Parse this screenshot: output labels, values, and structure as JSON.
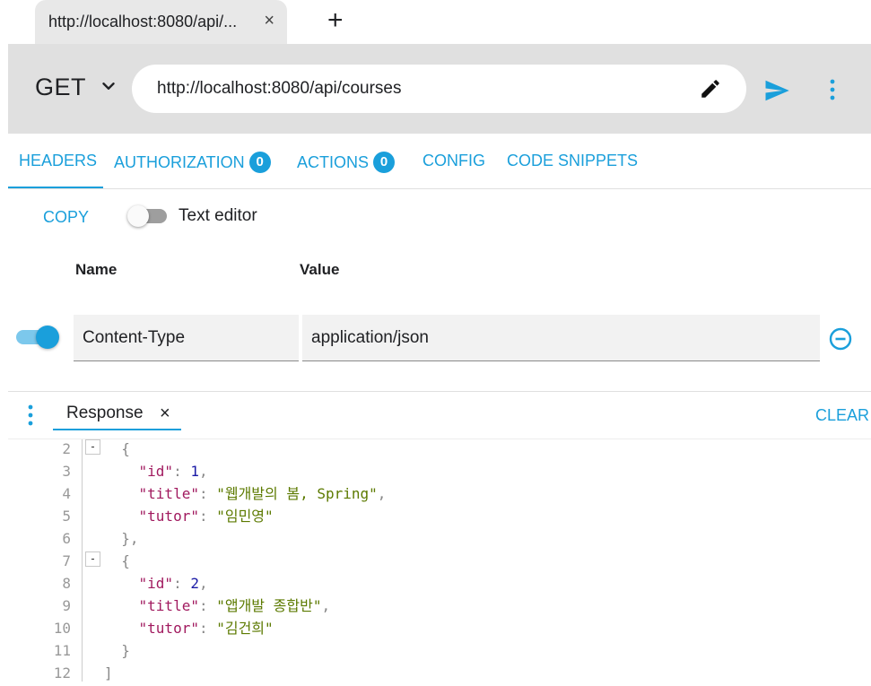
{
  "tab": {
    "title": "http://localhost:8080/api/...",
    "close_glyph": "×",
    "new_glyph": "+"
  },
  "request": {
    "method": "GET",
    "url": "http://localhost:8080/api/courses"
  },
  "section_tabs": [
    {
      "label": "HEADERS",
      "active": true
    },
    {
      "label": "AUTHORIZATION",
      "badge": "0"
    },
    {
      "label": "ACTIONS",
      "badge": "0"
    },
    {
      "label": "CONFIG"
    },
    {
      "label": "CODE SNIPPETS"
    }
  ],
  "headers_panel": {
    "copy_label": "COPY",
    "text_editor_label": "Text editor",
    "text_editor_enabled": false,
    "name_column": "Name",
    "value_column": "Value",
    "rows": [
      {
        "enabled": true,
        "name": "Content-Type",
        "value": "application/json"
      }
    ]
  },
  "response": {
    "tab_label": "Response",
    "close_glyph": "×",
    "clear_label": "CLEAR",
    "lines": [
      {
        "n": "2",
        "fold": "-",
        "tokens": [
          [
            "punc",
            "  {"
          ]
        ]
      },
      {
        "n": "3",
        "tokens": [
          [
            "key",
            "    \"id\""
          ],
          [
            "punc",
            ": "
          ],
          [
            "num",
            "1"
          ],
          [
            "punc",
            ","
          ]
        ]
      },
      {
        "n": "4",
        "tokens": [
          [
            "key",
            "    \"title\""
          ],
          [
            "punc",
            ": "
          ],
          [
            "str",
            "\"웹개발의 봄, Spring\""
          ],
          [
            "punc",
            ","
          ]
        ]
      },
      {
        "n": "5",
        "tokens": [
          [
            "key",
            "    \"tutor\""
          ],
          [
            "punc",
            ": "
          ],
          [
            "str",
            "\"임민영\""
          ]
        ]
      },
      {
        "n": "6",
        "tokens": [
          [
            "punc",
            "  },"
          ]
        ]
      },
      {
        "n": "7",
        "fold": "-",
        "tokens": [
          [
            "punc",
            "  {"
          ]
        ]
      },
      {
        "n": "8",
        "tokens": [
          [
            "key",
            "    \"id\""
          ],
          [
            "punc",
            ": "
          ],
          [
            "num",
            "2"
          ],
          [
            "punc",
            ","
          ]
        ]
      },
      {
        "n": "9",
        "tokens": [
          [
            "key",
            "    \"title\""
          ],
          [
            "punc",
            ": "
          ],
          [
            "str",
            "\"앱개발 종합반\""
          ],
          [
            "punc",
            ","
          ]
        ]
      },
      {
        "n": "10",
        "tokens": [
          [
            "key",
            "    \"tutor\""
          ],
          [
            "punc",
            ": "
          ],
          [
            "str",
            "\"김건희\""
          ]
        ]
      },
      {
        "n": "11",
        "tokens": [
          [
            "punc",
            "  }"
          ]
        ]
      },
      {
        "n": "12",
        "tokens": [
          [
            "punc",
            "]"
          ]
        ]
      }
    ]
  },
  "icons": {
    "method_dropdown": "chevron-down-icon",
    "edit_url": "pencil-icon",
    "send": "send-icon",
    "more": "more-vert-icon",
    "remove_header": "remove-circle-icon"
  },
  "colors": {
    "accent": "#1a9fdb",
    "bar": "#e0e0e0",
    "json_key": "#a11a5f",
    "json_string": "#5c7a00"
  }
}
